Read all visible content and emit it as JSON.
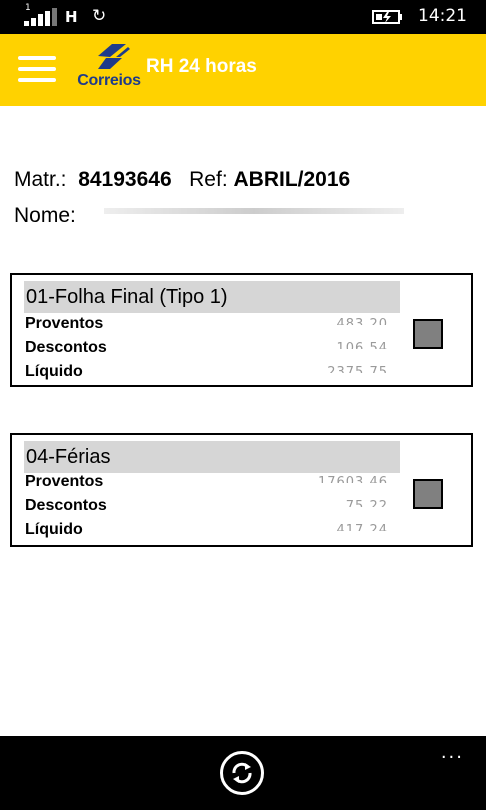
{
  "status_bar": {
    "sim": "1",
    "network": "H",
    "time": "14:21"
  },
  "header": {
    "logo_text": "Correios",
    "title": "RH 24 horas"
  },
  "info": {
    "matr_label": "Matr.:",
    "matr_value": "84193646",
    "ref_label": "Ref:",
    "ref_value": "ABRIL/2016",
    "nome_label": "Nome:"
  },
  "cards": [
    {
      "title": "01-Folha Final (Tipo 1)",
      "rows": [
        {
          "label": "Proventos",
          "value": "483,20"
        },
        {
          "label": "Descontos",
          "value": "106,54"
        },
        {
          "label": "Líquido",
          "value": "2375,75"
        }
      ]
    },
    {
      "title": "04-Férias",
      "rows": [
        {
          "label": "Proventos",
          "value": "17603,46"
        },
        {
          "label": "Descontos",
          "value": "75,22"
        },
        {
          "label": "Líquido",
          "value": "417,24"
        }
      ]
    }
  ],
  "bottom_bar": {
    "more": "..."
  },
  "colors": {
    "header": "#ffd200",
    "logo_blue": "#1f3b8a",
    "card_title_bg": "#d6d6d6",
    "checkbox": "#808080"
  }
}
